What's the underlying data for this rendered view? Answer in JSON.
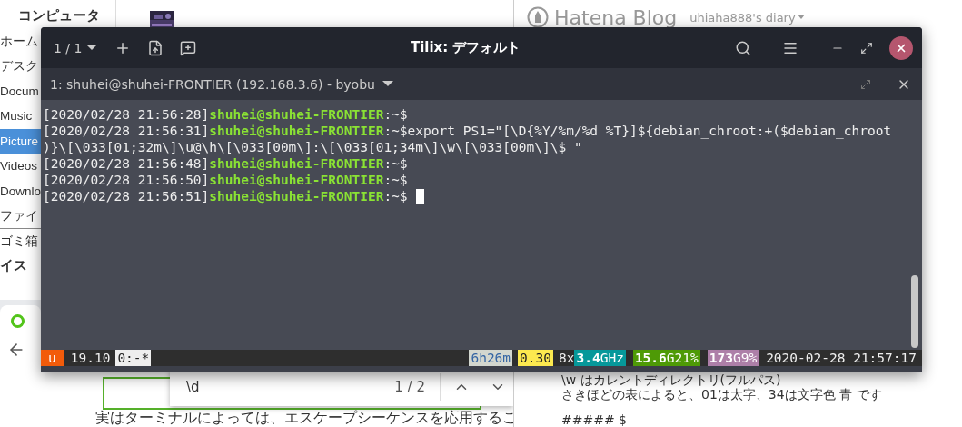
{
  "file_manager": {
    "sidebar": [
      {
        "kind": "header",
        "label": "コンピュータ",
        "selected": false
      },
      {
        "kind": "item",
        "label": "ホーム",
        "selected": false
      },
      {
        "kind": "item",
        "label": "デスク",
        "selected": false
      },
      {
        "kind": "item",
        "label": "Docum",
        "selected": false
      },
      {
        "kind": "item",
        "label": "Music",
        "selected": false
      },
      {
        "kind": "item",
        "label": "Picture",
        "selected": true
      },
      {
        "kind": "item",
        "label": "Videos",
        "selected": false
      },
      {
        "kind": "item",
        "label": "Downlo",
        "selected": false
      },
      {
        "kind": "item",
        "label": "ファイ",
        "selected": false,
        "divider_after": true
      },
      {
        "kind": "item",
        "label": "ゴミ箱",
        "selected": false
      },
      {
        "kind": "cut_header",
        "label": "イス",
        "selected": false
      }
    ]
  },
  "blog": {
    "logo": "Hatena Blog",
    "blog_menu": "uhiaha888's diary",
    "editor_lines": [
      {
        "kind": "text",
        "text": "\\w はカレントディレクトリ(フルパス)"
      },
      {
        "kind": "code",
        "text": "さきほどの表によると、01は太字、34は文字色 青 です"
      },
      {
        "kind": "text",
        "text": "##### $"
      }
    ]
  },
  "browser": {
    "tabs": [
      {
        "selected": true
      }
    ],
    "find_bar": {
      "query": "\\d",
      "count": "1 / 2"
    },
    "paragraph": "実はターミナルによっては、エスケープシーケンスを応用するこ"
  },
  "terminal": {
    "tab_counter": "1 / 1",
    "title": "Tilix: デフォルト",
    "session": "1: shuhei@shuhei-FRONTIER (192.168.3.6) - byobu",
    "lines": [
      {
        "cursor": false,
        "segments": [
          {
            "kind": "time",
            "text": "[2020/02/28 21:56:28]"
          },
          {
            "kind": "user",
            "text": "shuhei@shuhei-FRONTIER"
          },
          {
            "kind": "plain",
            "text": ":~$"
          }
        ]
      },
      {
        "cursor": false,
        "segments": [
          {
            "kind": "time",
            "text": "[2020/02/28 21:56:31]"
          },
          {
            "kind": "user",
            "text": "shuhei@shuhei-FRONTIER"
          },
          {
            "kind": "plain",
            "text": ":~$export PS1=\"[\\D{%Y/%m/%d %T}]${debian_chroot:+($debian_chroot"
          }
        ]
      },
      {
        "cursor": false,
        "segments": [
          {
            "kind": "plain",
            "text": ")}\\[\\033[01;32m\\]\\u@\\h\\[\\033[00m\\]:\\[\\033[01;34m\\]\\w\\[\\033[00m\\]\\$ \""
          }
        ]
      },
      {
        "cursor": false,
        "segments": [
          {
            "kind": "time",
            "text": "[2020/02/28 21:56:48]"
          },
          {
            "kind": "user",
            "text": "shuhei@shuhei-FRONTIER"
          },
          {
            "kind": "plain",
            "text": ":~$"
          }
        ]
      },
      {
        "cursor": false,
        "segments": [
          {
            "kind": "time",
            "text": "[2020/02/28 21:56:50]"
          },
          {
            "kind": "user",
            "text": "shuhei@shuhei-FRONTIER"
          },
          {
            "kind": "plain",
            "text": ":~$"
          }
        ]
      },
      {
        "cursor": true,
        "segments": [
          {
            "kind": "time",
            "text": "[2020/02/28 21:56:51]"
          },
          {
            "kind": "user",
            "text": "shuhei@shuhei-FRONTIER"
          },
          {
            "kind": "plain",
            "text": ":~$"
          }
        ]
      }
    ],
    "status_bar": {
      "left": [
        {
          "kind": "distro",
          "text": "u"
        },
        {
          "kind": "plain",
          "text": "19.10"
        },
        {
          "kind": "window",
          "text": "0:-*"
        }
      ],
      "right": [
        {
          "kind": "uptime",
          "text": "6h26m"
        },
        {
          "kind": "load",
          "text": "0.30"
        },
        {
          "kind": "plain",
          "text": "8x"
        },
        {
          "kind": "cpu",
          "text": "**3.4**GHz"
        },
        {
          "kind": "memory",
          "text": "**15.6**G21%"
        },
        {
          "kind": "disk",
          "text": "**173**G9%"
        },
        {
          "kind": "plain",
          "text": "2020-02-28 21:57:17"
        }
      ]
    }
  }
}
